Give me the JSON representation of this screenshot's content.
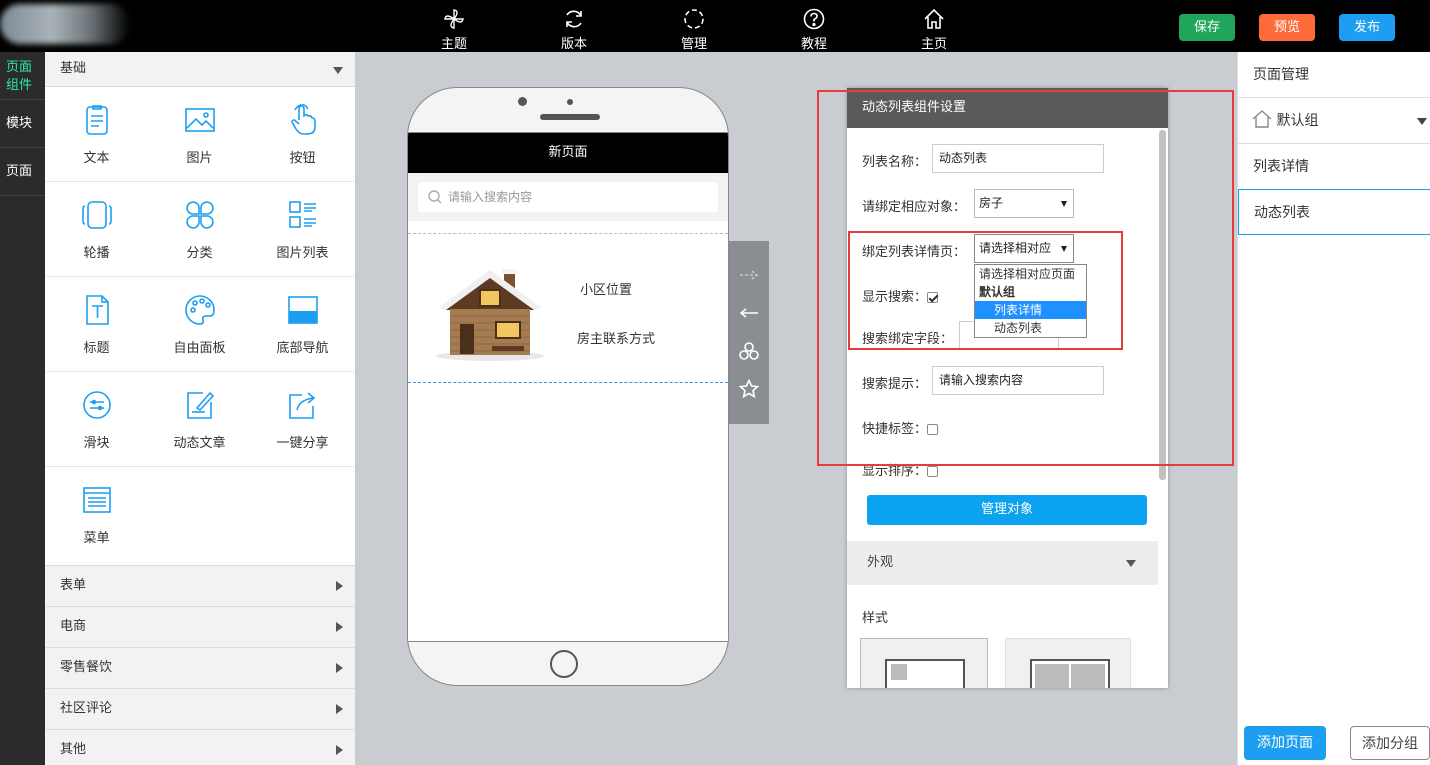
{
  "topnav": [
    {
      "label": "主题",
      "icon": "pinwheel-icon"
    },
    {
      "label": "版本",
      "icon": "refresh-icon"
    },
    {
      "label": "管理",
      "icon": "loading-circle-icon"
    },
    {
      "label": "教程",
      "icon": "help-icon"
    },
    {
      "label": "主页",
      "icon": "home-icon"
    }
  ],
  "toolbar": {
    "save": "保存",
    "preview": "预览",
    "publish": "发布"
  },
  "colors": {
    "save": "#1fa65a",
    "preview": "#ff6a3a",
    "publish": "#1e9ef0",
    "accent": "#0ba2ef"
  },
  "rail": [
    "页面\n组件",
    "模块",
    "页面"
  ],
  "components": {
    "section": "基础",
    "items": [
      "文本",
      "图片",
      "按钮",
      "轮播",
      "分类",
      "图片列表",
      "标题",
      "自由面板",
      "底部导航",
      "滑块",
      "动态文章",
      "一键分享",
      "菜单"
    ],
    "groups": [
      "表单",
      "电商",
      "零售餐饮",
      "社区评论",
      "其他"
    ]
  },
  "phone": {
    "title": "新页面",
    "search_placeholder": "请输入搜索内容",
    "item_line1": "小区位置",
    "item_line2": "房主联系方式"
  },
  "settings": {
    "title": "动态列表组件设置",
    "list_name_label": "列表名称：",
    "list_name_value": "动态列表",
    "bind_object_label": "请绑定相应对象：",
    "bind_object_value": "房子",
    "bind_detail_label": "绑定列表详情页：",
    "bind_detail_value": "请选择相对应",
    "show_search_label": "显示搜索：",
    "search_field_label": "搜索绑定字段：",
    "search_hint_label": "搜索提示：",
    "search_hint_value": "请输入搜索内容",
    "quick_tag_label": "快捷标签：",
    "show_sort_label": "显示排序：",
    "manage_button": "管理对象",
    "appearance": "外观",
    "style_label": "样式",
    "dropdown": {
      "placeholder": "请选择相对应页面",
      "group": "默认组",
      "options": [
        "列表详情",
        "动态列表"
      ]
    }
  },
  "page_manager": {
    "title": "页面管理",
    "group": "默认组",
    "pages": [
      "列表详情",
      "动态列表"
    ],
    "add_page": "添加页面",
    "add_group": "添加分组"
  }
}
